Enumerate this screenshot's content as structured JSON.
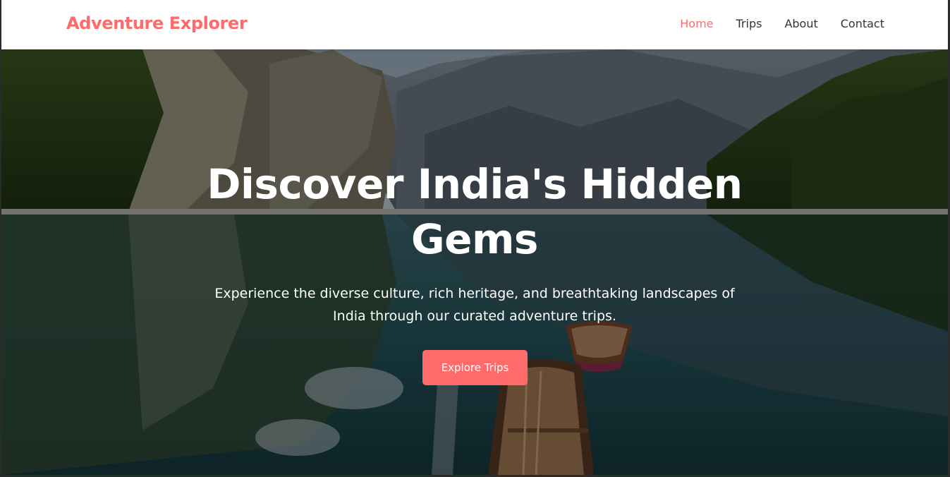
{
  "brand": {
    "name": "Adventure Explorer",
    "accent": "#ff6b6b"
  },
  "nav": {
    "items": [
      {
        "label": "Home",
        "active": true
      },
      {
        "label": "Trips",
        "active": false
      },
      {
        "label": "About",
        "active": false
      },
      {
        "label": "Contact",
        "active": false
      }
    ]
  },
  "hero": {
    "title": "Discover India's Hidden Gems",
    "subtitle": "Experience the diverse culture, rich heritage, and breathtaking landscapes of India through our curated adventure trips.",
    "cta_label": "Explore Trips"
  }
}
